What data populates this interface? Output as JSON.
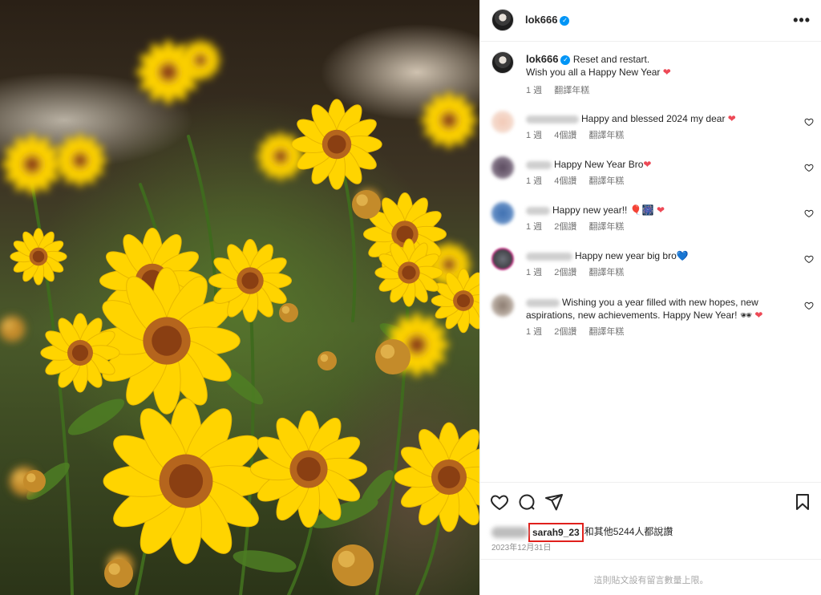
{
  "post": {
    "author": "lok666",
    "caption_line1": "Reset and restart.",
    "caption_line2": "Wish you all a Happy New Year",
    "caption_emoji": "❤",
    "caption_time": "1 週",
    "caption_translate": "翻譯年糕"
  },
  "comments": [
    {
      "text": "Happy and blessed 2024 my dear",
      "emoji": "❤",
      "time": "1 週",
      "likes": "4個讚",
      "translate": "翻譯年糕"
    },
    {
      "text": "Happy New Year Bro",
      "emoji": "❤",
      "time": "1 週",
      "likes": "4個讚",
      "translate": "翻譯年糕"
    },
    {
      "text": "Happy new year!! 🎈🎆",
      "emoji": "❤",
      "time": "1 週",
      "likes": "2個讚",
      "translate": "翻譯年糕"
    },
    {
      "text": "Happy new year big bro",
      "emoji": "💙",
      "time": "1 週",
      "likes": "2個讚",
      "translate": "翻譯年糕"
    },
    {
      "text": "Wishing you a year filled with new hopes, new aspirations, new achievements. Happy New Year! 🕶",
      "emoji": "❤",
      "time": "1 週",
      "likes": "2個讚",
      "translate": "翻譯年糕"
    }
  ],
  "likes": {
    "highlighted_user": "sarah9_23",
    "rest": "和其他5244人都說讚"
  },
  "date": "2023年12月31日",
  "footer": "這則貼文設有留言數量上限。",
  "colors": {
    "verified": "#0095f6",
    "highlight_box": "#e0201c",
    "heart": "#ed4956"
  },
  "icons": [
    "verified-icon",
    "more-icon",
    "like-icon",
    "comment-icon",
    "share-icon",
    "bookmark-icon"
  ]
}
